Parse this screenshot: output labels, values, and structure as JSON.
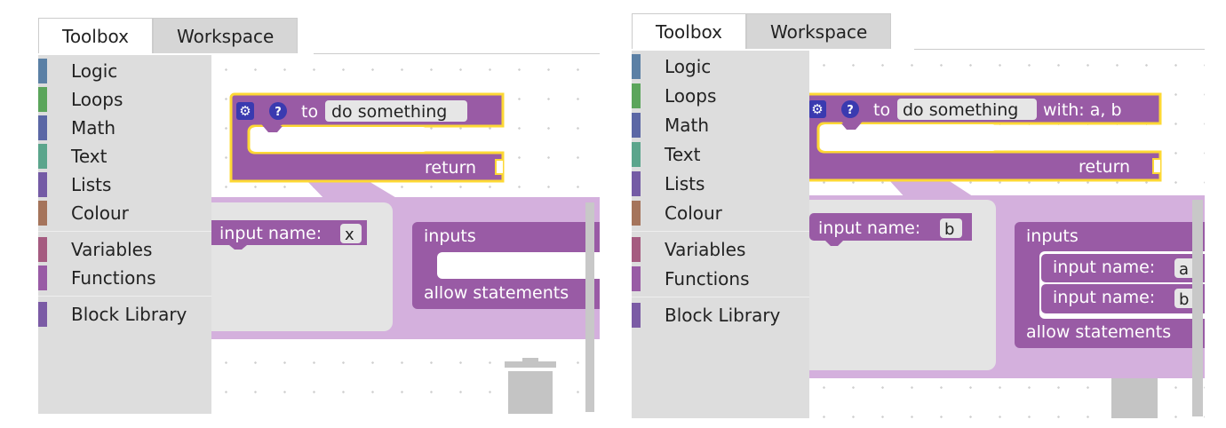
{
  "tabs": {
    "toolbox": "Toolbox",
    "workspace": "Workspace"
  },
  "categories": [
    {
      "label": "Logic",
      "color": "#5b80a5"
    },
    {
      "label": "Loops",
      "color": "#5ba55b"
    },
    {
      "label": "Math",
      "color": "#5b67a5"
    },
    {
      "label": "Text",
      "color": "#5ba58c"
    },
    {
      "label": "Lists",
      "color": "#745ba5"
    },
    {
      "label": "Colour",
      "color": "#a5745b"
    },
    {
      "label": "Variables",
      "color": "#a55b80"
    },
    {
      "label": "Functions",
      "color": "#995ba5"
    },
    {
      "label": "Block Library",
      "color": "#7b5ba5"
    }
  ],
  "colors": {
    "block": "#995ba5",
    "block_dark": "#7a4886",
    "highlight": "#fdd835",
    "bubble": "#d4b0dd",
    "mutator_bg": "#e4e4e4"
  },
  "left": {
    "func": {
      "to": "to",
      "name": "do something",
      "params": "",
      "return": "return"
    },
    "mutator": {
      "input_label": "input name:",
      "input_value": "x",
      "inputs": "inputs",
      "allow": "allow statements"
    }
  },
  "right": {
    "func": {
      "to": "to",
      "name": "do something",
      "params": "with: a, b",
      "return": "return"
    },
    "mutator": {
      "input_label": "input name:",
      "input_value": "b",
      "inputs": "inputs",
      "allow": "allow statements",
      "rows": [
        {
          "label": "input name:",
          "value": "a"
        },
        {
          "label": "input name:",
          "value": "b"
        }
      ]
    }
  },
  "icons": {
    "gear": "gear-icon",
    "help": "help-icon",
    "trash": "trashcan-icon"
  },
  "help_glyph": "?",
  "gear_glyph": "⚙"
}
